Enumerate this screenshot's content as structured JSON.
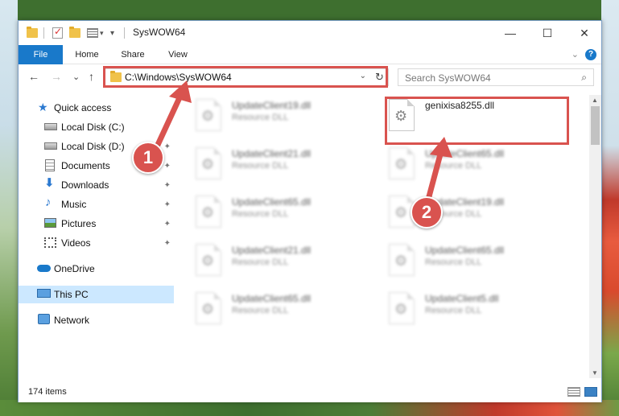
{
  "window": {
    "title": "SysWOW64",
    "minimize_glyph": "—",
    "maximize_glyph": "☐",
    "close_glyph": "✕"
  },
  "ribbon": {
    "tabs": [
      "File",
      "Home",
      "Share",
      "View"
    ],
    "help_glyph": "?",
    "collapse_glyph": "⌄"
  },
  "address": {
    "path": "C:\\Windows\\SysWOW64",
    "back_glyph": "←",
    "forward_glyph": "→",
    "recent_glyph": "⌄",
    "up_glyph": "↑",
    "dropdown_glyph": "⌄",
    "refresh_glyph": "↻"
  },
  "search": {
    "placeholder": "Search SysWOW64",
    "icon_glyph": "⌕"
  },
  "nav": {
    "items": [
      {
        "label": "Quick access",
        "icon": "star-icon",
        "pinned": false
      },
      {
        "label": "Local Disk (C:)",
        "icon": "drive-icon",
        "pinned": true
      },
      {
        "label": "Local Disk (D:)",
        "icon": "drive-icon",
        "pinned": true
      },
      {
        "label": "Documents",
        "icon": "documents-icon",
        "pinned": true
      },
      {
        "label": "Downloads",
        "icon": "download-icon",
        "pinned": true
      },
      {
        "label": "Music",
        "icon": "music-icon",
        "pinned": true
      },
      {
        "label": "Pictures",
        "icon": "pictures-icon",
        "pinned": true
      },
      {
        "label": "Videos",
        "icon": "videos-icon",
        "pinned": true
      },
      {
        "label": "OneDrive",
        "icon": "cloud-icon",
        "pinned": false
      },
      {
        "label": "This PC",
        "icon": "computer-icon",
        "pinned": false,
        "selected": true
      },
      {
        "label": "Network",
        "icon": "network-icon",
        "pinned": false
      }
    ],
    "pin_glyph": "📌"
  },
  "files": [
    {
      "name": "UpdateClient19.dll",
      "type": "Resource DLL",
      "blurred": true
    },
    {
      "name": "genixisa8255.dll",
      "type": "",
      "blurred": false
    },
    {
      "name": "UpdateClient21.dll",
      "type": "Resource DLL",
      "blurred": true
    },
    {
      "name": "UpdateClient65.dll",
      "type": "Resource DLL",
      "blurred": true
    },
    {
      "name": "UpdateClient65.dll",
      "type": "Resource DLL",
      "blurred": true
    },
    {
      "name": "UpdateClient19.dll",
      "type": "Resource DLL",
      "blurred": true
    },
    {
      "name": "UpdateClient21.dll",
      "type": "Resource DLL",
      "blurred": true
    },
    {
      "name": "UpdateClient65.dll",
      "type": "Resource DLL",
      "blurred": true
    },
    {
      "name": "UpdateClient65.dll",
      "type": "Resource DLL",
      "blurred": true
    },
    {
      "name": "UpdateClient5.dll",
      "type": "Resource DLL",
      "blurred": true
    }
  ],
  "status": {
    "item_count": "174 items"
  },
  "annotations": {
    "step1": "1",
    "step2": "2",
    "color": "#d9534f"
  },
  "colors": {
    "accent": "#1979ca",
    "selected_bg": "#cce8ff",
    "highlight": "#d9534f"
  }
}
